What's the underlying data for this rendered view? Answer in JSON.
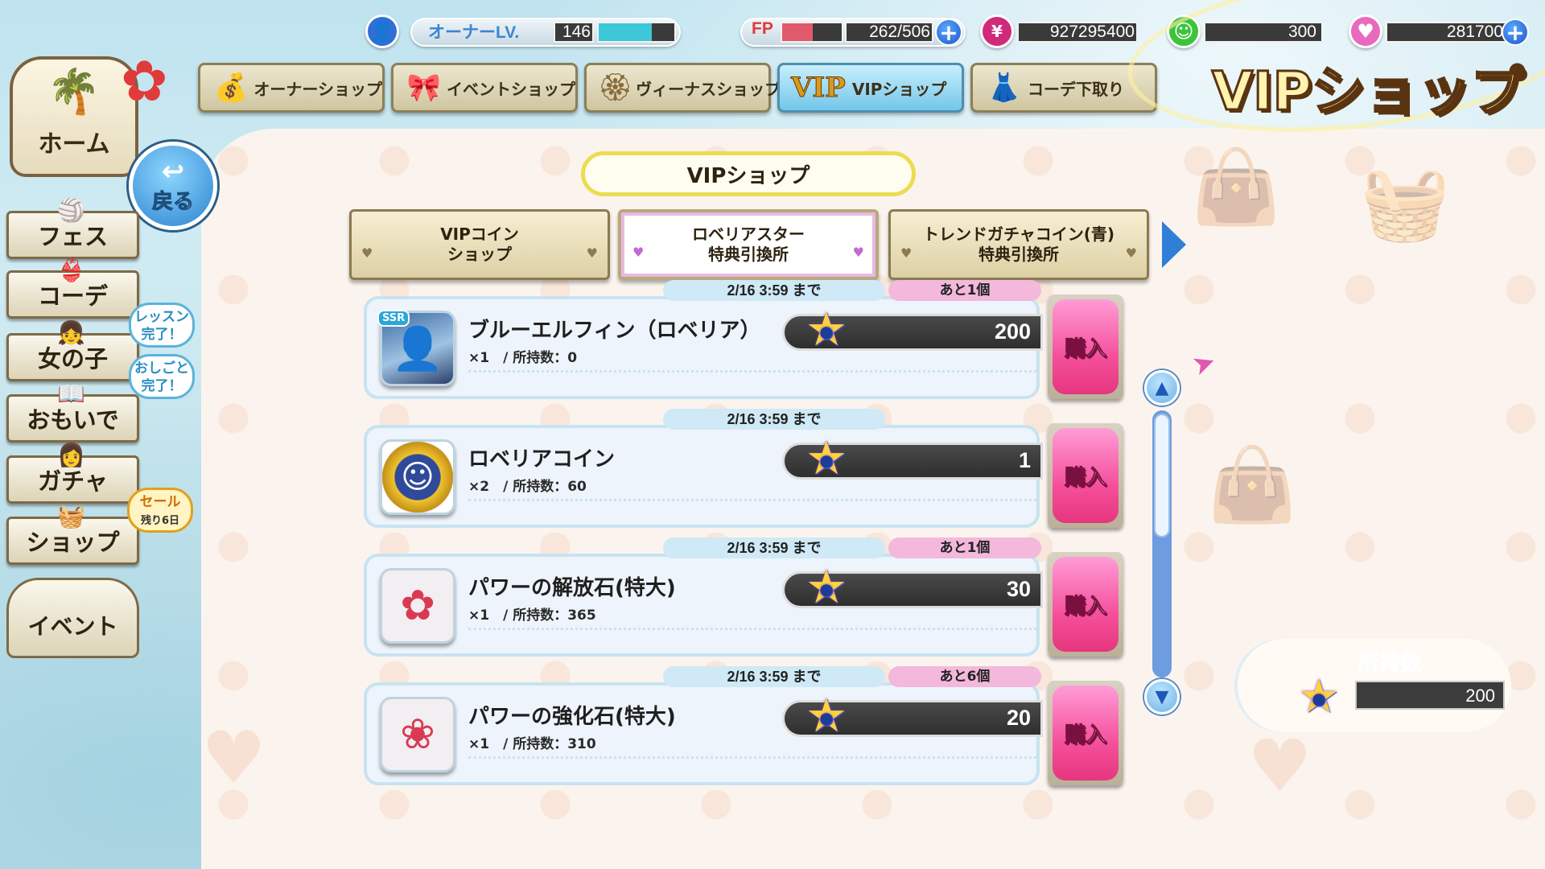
{
  "status": {
    "owner_label": "オーナーLV.",
    "owner_level": "146",
    "owner_level_progress": 0.7,
    "fp_label": "FP",
    "fp_value": "262/506",
    "fp_progress": 0.52,
    "currency_1": "927295400",
    "currency_2": "300",
    "currency_3": "281700",
    "plus": "+"
  },
  "shop_tabs": [
    {
      "label": "オーナーショップ",
      "icon": "coin-bag-icon"
    },
    {
      "label": "イベントショップ",
      "icon": "ribbon-icon"
    },
    {
      "label": "ヴィーナスショップ",
      "icon": "venus-icon"
    },
    {
      "label": "VIPショップ",
      "icon": "vip-icon",
      "mark": "VIP"
    },
    {
      "label": "コーデ下取り",
      "icon": "dress-icon"
    }
  ],
  "page_title": "VIPショップ",
  "nav": {
    "home": "ホーム",
    "back": "戻る",
    "back_arrow": "↩",
    "items": [
      "フェス",
      "コーデ",
      "女の子",
      "おもいで",
      "ガチャ",
      "ショップ"
    ],
    "event": "イベント",
    "bubble_lesson": "レッスン\n完了！",
    "bubble_work": "おしごと\n完了！",
    "bubble_sale": "セール",
    "bubble_sale_sub": "残り6日"
  },
  "header": "VIPショップ",
  "category_tabs": [
    {
      "line1": "VIPコイン",
      "line2": "ショップ"
    },
    {
      "line1": "ロベリアスター",
      "line2": "特典引換所"
    },
    {
      "line1": "トレンドガチャコイン(青)",
      "line2": "特典引換所"
    }
  ],
  "items": [
    {
      "deadline": "2/16 3:59 まで",
      "remaining": "あと1個",
      "name": "ブルーエルフィン（ロベリア）",
      "meta": "×1　/ 所持数：0",
      "price": "200",
      "badge": "SSR",
      "thumb": "card-icon"
    },
    {
      "deadline": "2/16 3:59 まで",
      "remaining": "",
      "name": "ロベリアコイン",
      "meta": "×2　/ 所持数：60",
      "price": "1",
      "badge": "",
      "thumb": "coin-icon"
    },
    {
      "deadline": "2/16 3:59 まで",
      "remaining": "あと1個",
      "name": "パワーの解放石(特大)",
      "meta": "×1　/ 所持数：365",
      "price": "30",
      "badge": "",
      "thumb": "flower-icon"
    },
    {
      "deadline": "2/16 3:59 まで",
      "remaining": "あと6個",
      "name": "パワーの強化石(特大)",
      "meta": "×1　/ 所持数：310",
      "price": "20",
      "badge": "",
      "thumb": "lotus-icon"
    }
  ],
  "buy_label": "購入",
  "owned": {
    "label": "所持数",
    "value": "200"
  },
  "colors": {
    "accent": "#2f7fd6",
    "buy": "#f5509c",
    "header_border": "#ecdc52"
  }
}
